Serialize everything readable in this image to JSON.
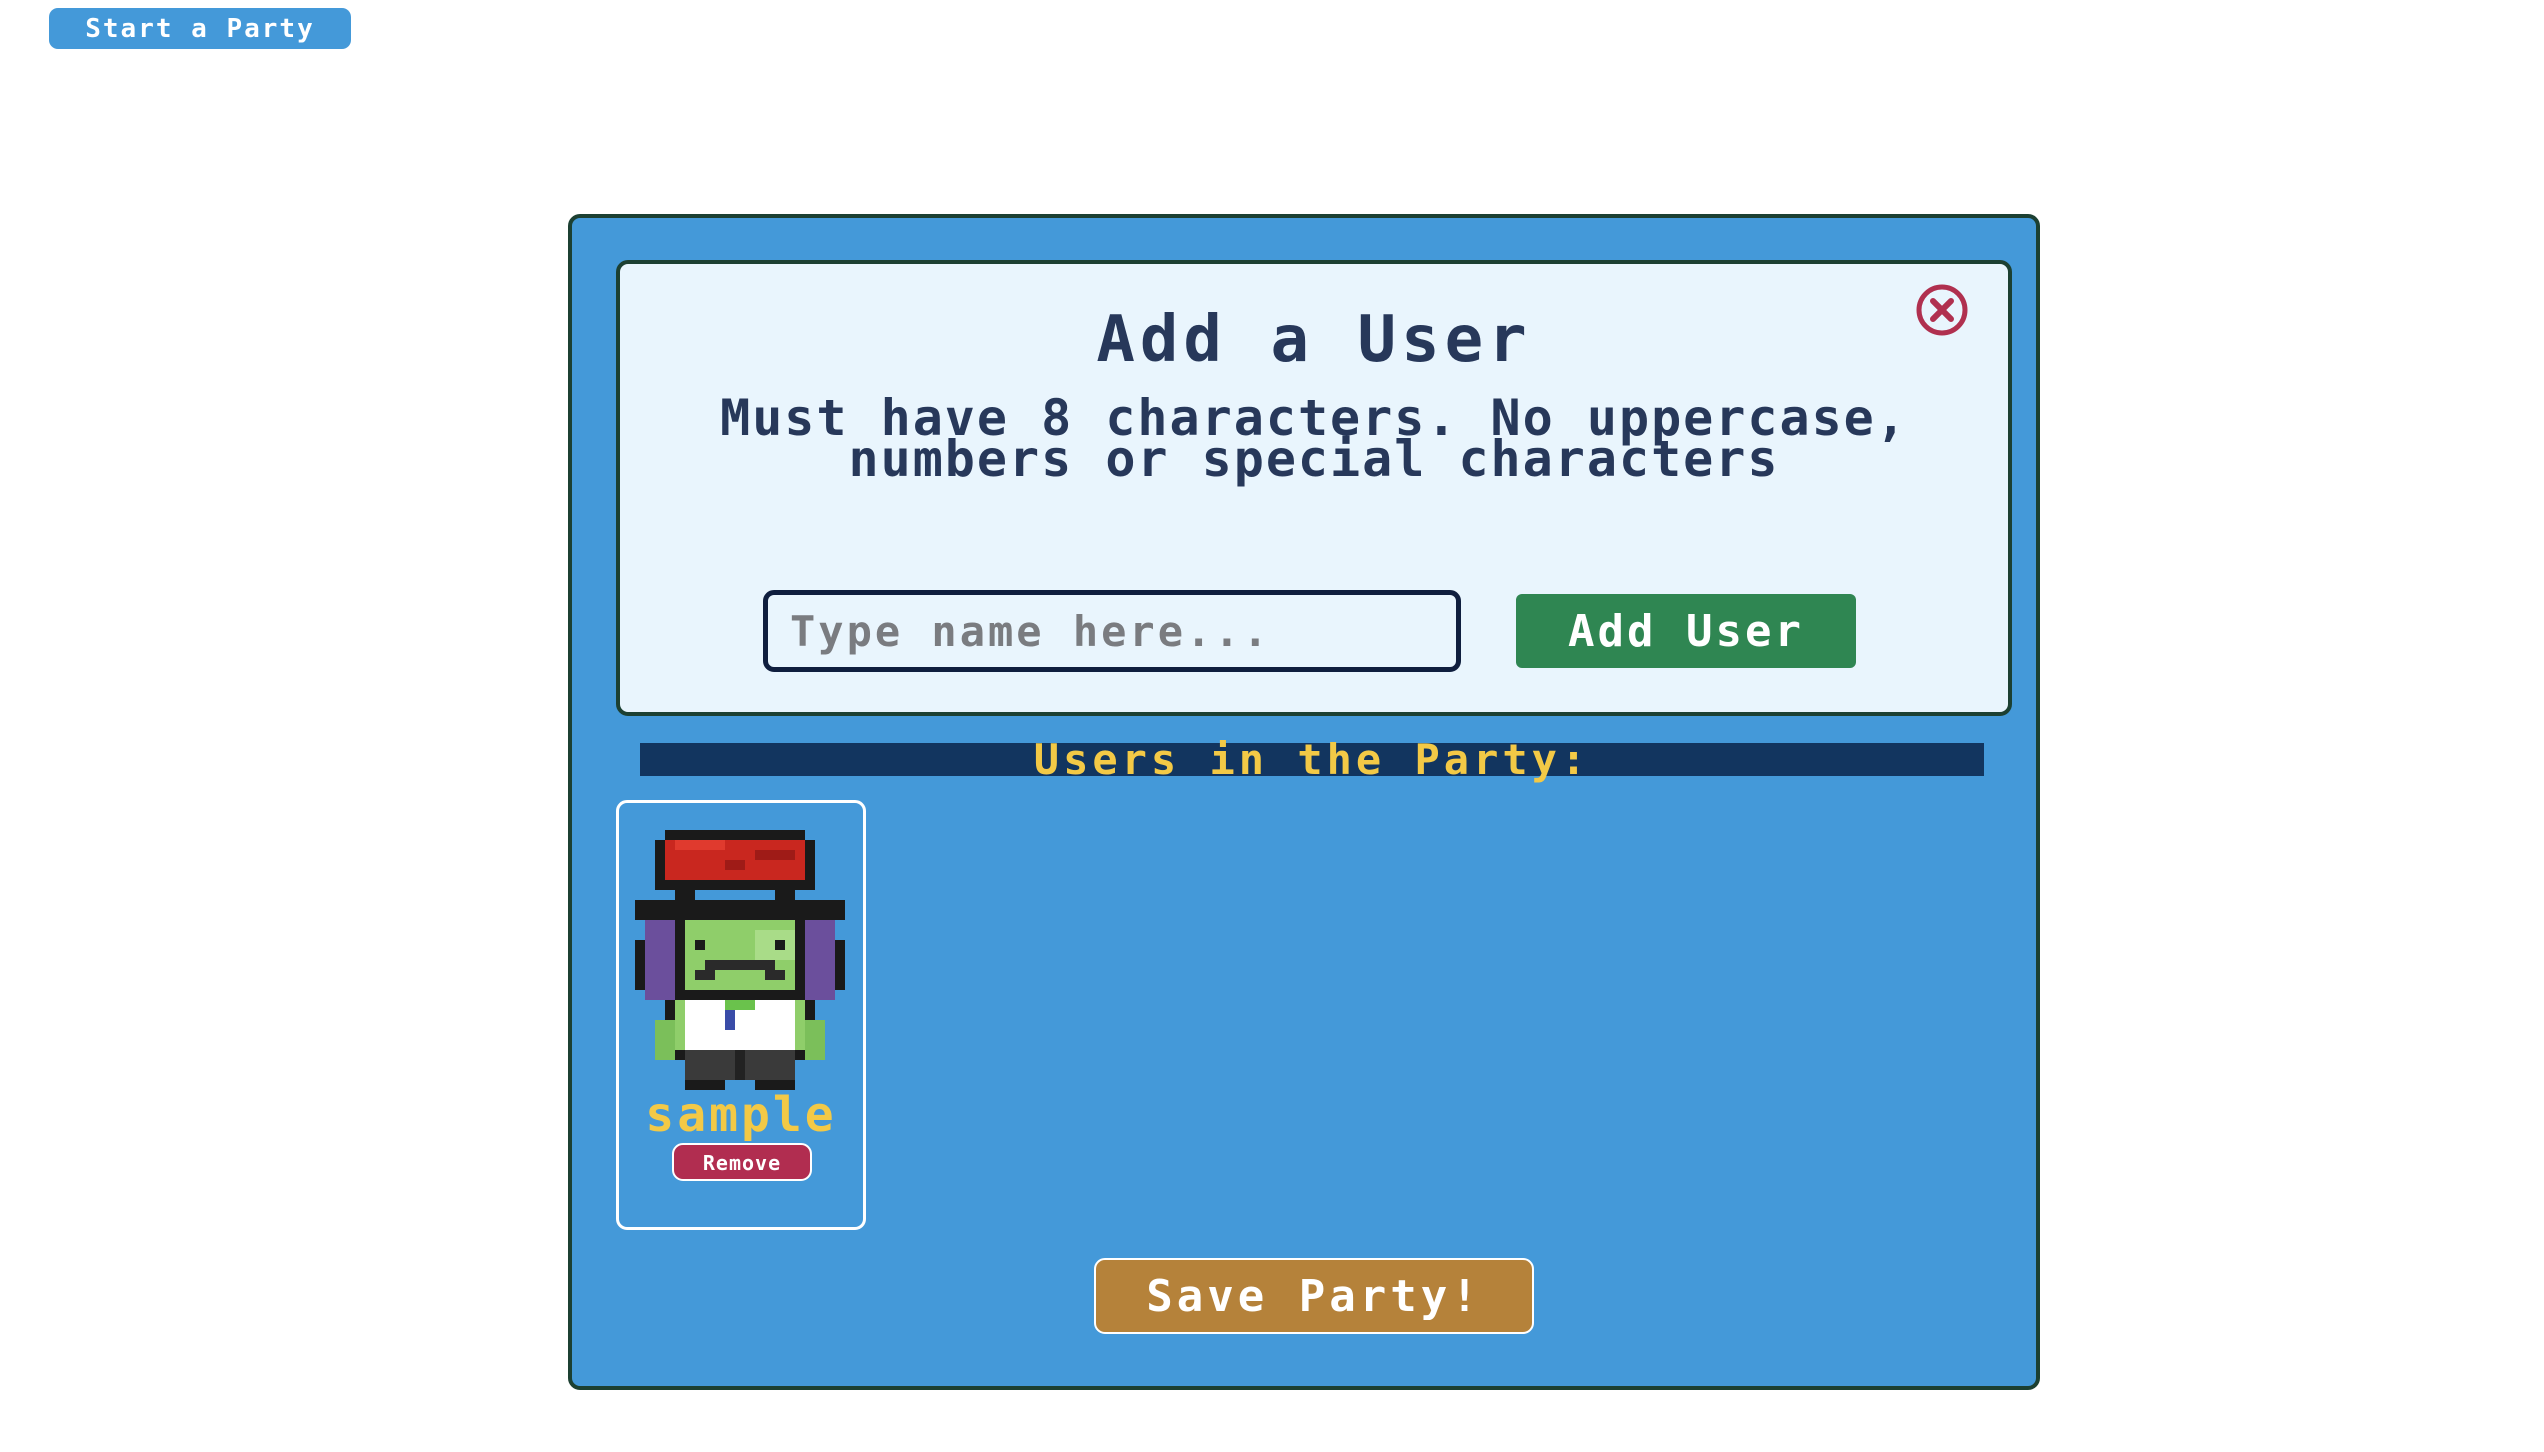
{
  "toolbar": {
    "start_party_label": "Start a Party"
  },
  "modal": {
    "title": "Add a User",
    "rule_text": "Must have 8 characters. No uppercase, numbers or special characters",
    "close_icon": "close-circle-icon",
    "name_input": {
      "placeholder": "Type name here...",
      "value": ""
    },
    "add_user_label": "Add User",
    "party_header": "Users in the Party:",
    "users": [
      {
        "name": "sample",
        "avatar": "pixel-zombie-red-hair-avatar",
        "remove_label": "Remove"
      }
    ],
    "save_label": "Save Party!"
  },
  "colors": {
    "primary_blue": "#4499d9",
    "panel_bg": "#e9f5fd",
    "text_navy": "#27385a",
    "accent_gold": "#f3c946",
    "header_band": "#12355f",
    "add_green": "#2f8652",
    "remove_red": "#b12d50",
    "save_orange": "#b5823a",
    "close_red": "#b0304f"
  }
}
